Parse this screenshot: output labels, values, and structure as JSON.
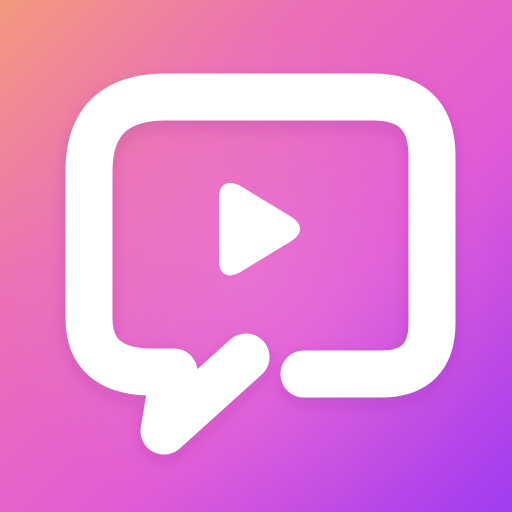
{
  "app_icon": {
    "name": "video-chat-app-icon",
    "glyph": "chat-bubble-play-icon",
    "colors": {
      "gradient_top_left": "#F39A7E",
      "gradient_mid": "#EC6FB7",
      "gradient_center": "#E25BD6",
      "gradient_bottom_right": "#A03CF2",
      "glyph": "#FFFFFF"
    }
  }
}
